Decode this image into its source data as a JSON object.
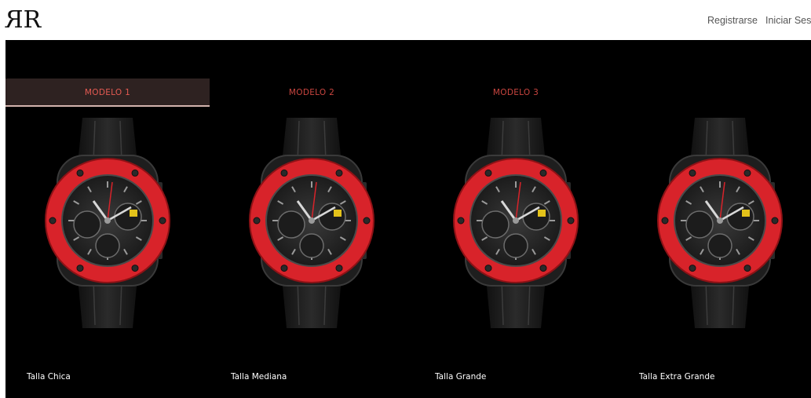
{
  "header": {
    "logo_icon": "rr-monogram-logo",
    "register_label": "Registrarse",
    "login_label": "Iniciar Sesion"
  },
  "tabs": [
    {
      "label": "MODELO 1",
      "active": true
    },
    {
      "label": "MODELO 2",
      "active": false
    },
    {
      "label": "MODELO 3",
      "active": false
    }
  ],
  "products": [
    {
      "size_label": "Talla Chica",
      "image_icon": "watch-icon"
    },
    {
      "size_label": "Talla Mediana",
      "image_icon": "watch-icon"
    },
    {
      "size_label": "Talla Grande",
      "image_icon": "watch-icon"
    },
    {
      "size_label": "Talla Extra Grande",
      "image_icon": "watch-icon"
    }
  ],
  "colors": {
    "hero_background": "#000000",
    "tab_text": "#c9453f",
    "tab_active_background": "#2e2221",
    "bezel_red": "#d8232a",
    "strap": "#1e1e1e"
  }
}
